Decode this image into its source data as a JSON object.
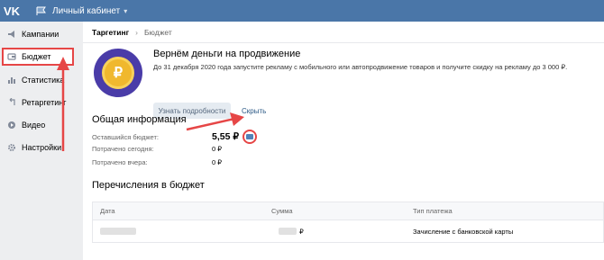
{
  "topbar": {
    "logo": "VK",
    "cabinet_label": "Личный кабинет"
  },
  "sidebar": {
    "items": [
      {
        "label": "Кампании",
        "icon": "megaphone-icon"
      },
      {
        "label": "Бюджет",
        "icon": "wallet-icon",
        "active": true
      },
      {
        "label": "Статистика",
        "icon": "chart-icon"
      },
      {
        "label": "Ретаргетинг",
        "icon": "retarget-icon"
      },
      {
        "label": "Видео",
        "icon": "video-icon"
      },
      {
        "label": "Настройки",
        "icon": "gear-icon"
      }
    ]
  },
  "breadcrumb": {
    "part1": "Таргетинг",
    "separator": "›",
    "part2": "Бюджет"
  },
  "promo": {
    "coin_symbol": "₽",
    "title": "Вернём деньги на продвижение",
    "text": "До 31 декабря 2020 года запустите рекламу с мобильного или автопродвижение товаров и получите скидку на рекламу до 3 000 ₽.",
    "more_button": "Узнать подробности",
    "hide_button": "Скрыть"
  },
  "general": {
    "title": "Общая информация",
    "rows": [
      {
        "label": "Оставшийся бюджет:",
        "value": "5,55 ₽"
      },
      {
        "label": "Потрачено сегодня:",
        "value": "0 ₽"
      },
      {
        "label": "Потрачено вчера:",
        "value": "0 ₽"
      }
    ]
  },
  "transfers": {
    "title": "Перечисления в бюджет",
    "columns": [
      "Дата",
      "Сумма",
      "Тип платежа"
    ],
    "rows": [
      {
        "amount_suffix": "₽",
        "type": "Зачисление с банковской карты"
      }
    ]
  },
  "colors": {
    "topbar": "#4a76a8",
    "highlight": "#e64646",
    "link": "#2a5885"
  }
}
